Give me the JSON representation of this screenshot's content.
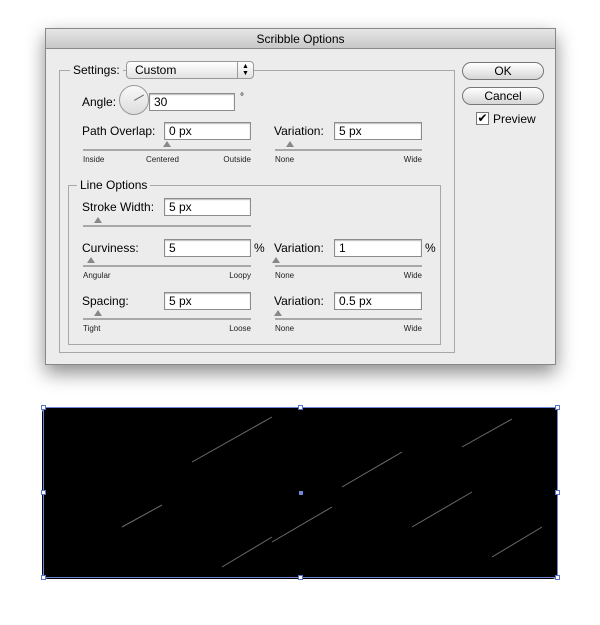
{
  "dialog": {
    "title": "Scribble Options"
  },
  "settings": {
    "label": "Settings:",
    "value": "Custom"
  },
  "angle": {
    "label": "Angle:",
    "value": "30",
    "unit": "°"
  },
  "path_overlap": {
    "label": "Path Overlap:",
    "value": "0 px",
    "slider": 0.5,
    "ticks": [
      "Inside",
      "Centered",
      "Outside"
    ]
  },
  "path_variation": {
    "label": "Variation:",
    "value": "5 px",
    "slider": 0.1,
    "ticks": [
      "None",
      "Wide"
    ]
  },
  "line_options": {
    "title": "Line Options",
    "stroke_width": {
      "label": "Stroke Width:",
      "value": "5 px",
      "slider": 0.09
    },
    "curviness": {
      "label": "Curviness:",
      "value": "5",
      "unit": "%",
      "slider": 0.05,
      "ticks": [
        "Angular",
        "Loopy"
      ]
    },
    "curviness_variation": {
      "label": "Variation:",
      "value": "1",
      "unit": "%",
      "slider": 0.01,
      "ticks": [
        "None",
        "Wide"
      ]
    },
    "spacing": {
      "label": "Spacing:",
      "value": "5 px",
      "slider": 0.09,
      "ticks": [
        "Tight",
        "Loose"
      ]
    },
    "spacing_variation": {
      "label": "Variation:",
      "value": "0.5 px",
      "slider": 0.02,
      "ticks": [
        "None",
        "Wide"
      ]
    }
  },
  "buttons": {
    "ok": "OK",
    "cancel": "Cancel",
    "preview": "Preview",
    "preview_checked": true
  }
}
